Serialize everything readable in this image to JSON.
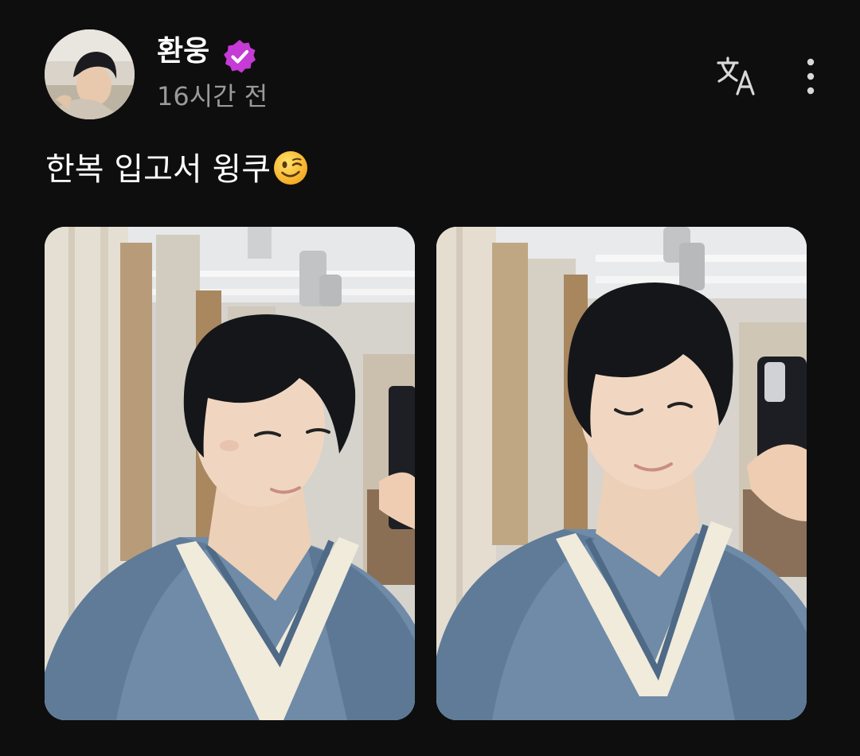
{
  "post": {
    "author": {
      "name": "환웅",
      "verified": true,
      "timestamp": "16시간 전"
    },
    "text": "한복 입고서 윙쿠",
    "emoji": "winking-face",
    "photos": [
      {
        "subject": "mirror selfie, blue hanbok, looking sideways"
      },
      {
        "subject": "mirror selfie, blue hanbok, winking"
      }
    ],
    "actions": {
      "translate_icon": "translate-icon",
      "more_icon": "more-vertical-icon"
    }
  },
  "colors": {
    "background": "#0e0e0e",
    "text_primary": "#ffffff",
    "text_secondary": "#9a9a9a",
    "verified_badge": "#c63ad6",
    "hanbok_blue": "#6f8ba7"
  }
}
